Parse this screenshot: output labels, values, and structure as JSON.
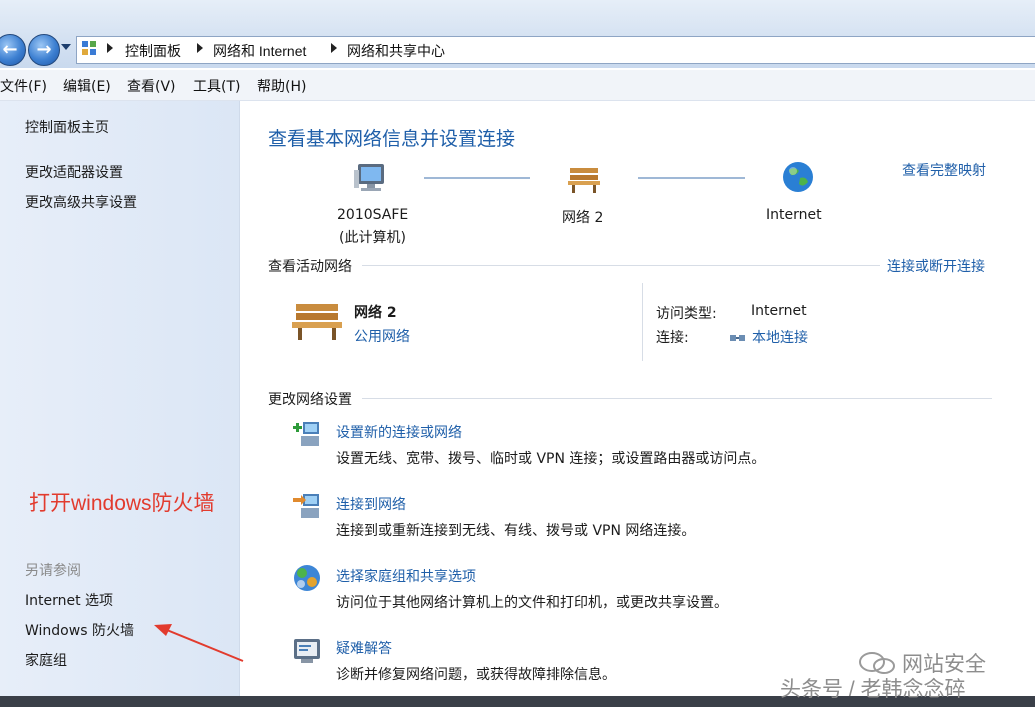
{
  "addressbar": {
    "breadcrumbs": [
      "控制面板",
      "网络和 Internet",
      "网络和共享中心"
    ]
  },
  "menubar": {
    "items": [
      "文件(F)",
      "编辑(E)",
      "查看(V)",
      "工具(T)",
      "帮助(H)"
    ]
  },
  "sidebar": {
    "home": "控制面板主页",
    "tasks": [
      "更改适配器设置",
      "更改高级共享设置"
    ],
    "see_also_heading": "另请参阅",
    "see_also": [
      "Internet 选项",
      "Windows 防火墙",
      "家庭组"
    ]
  },
  "annotation": {
    "text": "打开windows防火墙",
    "color": "#e23b2e"
  },
  "main": {
    "title": "查看基本网络信息并设置连接",
    "view_full_map": "查看完整映射",
    "map": {
      "computer_name": "2010SAFE",
      "computer_note": "(此计算机)",
      "network_name": "网络  2",
      "internet_name": "Internet"
    },
    "active_networks": {
      "heading": "查看活动网络",
      "connect_link": "连接或断开连接",
      "network_name": "网络  2",
      "network_type": "公用网络",
      "access_type_label": "访问类型:",
      "access_type_value": "Internet",
      "connections_label": "连接:",
      "connections_value": "本地连接"
    },
    "change_settings": {
      "heading": "更改网络设置",
      "tasks": [
        {
          "title": "设置新的连接或网络",
          "desc": "设置无线、宽带、拨号、临时或 VPN 连接；或设置路由器或访问点。",
          "icon": "new-connection-icon"
        },
        {
          "title": "连接到网络",
          "desc": "连接到或重新连接到无线、有线、拨号或 VPN 网络连接。",
          "icon": "connect-network-icon"
        },
        {
          "title": "选择家庭组和共享选项",
          "desc": "访问位于其他网络计算机上的文件和打印机，或更改共享设置。",
          "icon": "homegroup-icon"
        },
        {
          "title": "疑难解答",
          "desc": "诊断并修复网络问题，或获得故障排除信息。",
          "icon": "troubleshoot-icon"
        }
      ]
    }
  },
  "watermark": {
    "line1": "网站安全",
    "line2": "头条号 / 老韩念念碎"
  },
  "colors": {
    "link": "#1f5fa9",
    "annotation": "#e23b2e"
  }
}
